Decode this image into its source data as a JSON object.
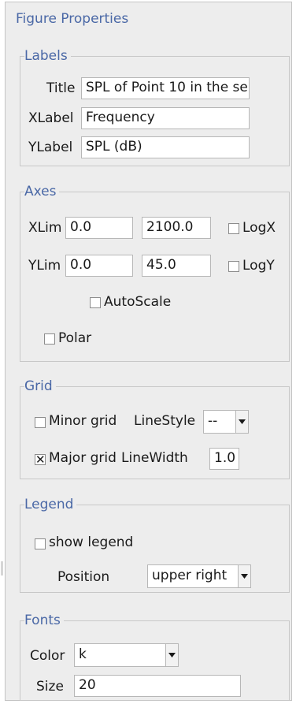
{
  "panel": {
    "title": "Figure Properties"
  },
  "labels": {
    "group_title": "Labels",
    "title_label": "Title",
    "title_value": "SPL of Point 10 in the se",
    "xlabel_label": "XLabel",
    "xlabel_value": "Frequency",
    "ylabel_label": "YLabel",
    "ylabel_value": "SPL (dB)"
  },
  "axes": {
    "group_title": "Axes",
    "xlim_label": "XLim",
    "xlim_min": "0.0",
    "xlim_max": "2100.0",
    "logx_label": "LogX",
    "logx_checked": false,
    "ylim_label": "YLim",
    "ylim_min": "0.0",
    "ylim_max": "45.0",
    "logy_label": "LogY",
    "logy_checked": false,
    "autoscale_label": "AutoScale",
    "autoscale_checked": false,
    "polar_label": "Polar",
    "polar_checked": false
  },
  "grid": {
    "group_title": "Grid",
    "minor_label": "Minor grid",
    "minor_checked": false,
    "linestyle_label": "LineStyle",
    "linestyle_value": "--",
    "major_label": "Major grid",
    "major_checked": true,
    "major_mark": "✕",
    "linewidth_label": "LineWidth",
    "linewidth_value": "1.0"
  },
  "legend": {
    "group_title": "Legend",
    "show_label": "show legend",
    "show_checked": false,
    "position_label": "Position",
    "position_value": "upper right"
  },
  "fonts": {
    "group_title": "Fonts",
    "color_label": "Color",
    "color_value": "k",
    "size_label": "Size",
    "size_value": "20"
  },
  "colors": {
    "accent": "#4a68a6",
    "panel_bg": "#ededed",
    "border": "#c8c8c8"
  }
}
